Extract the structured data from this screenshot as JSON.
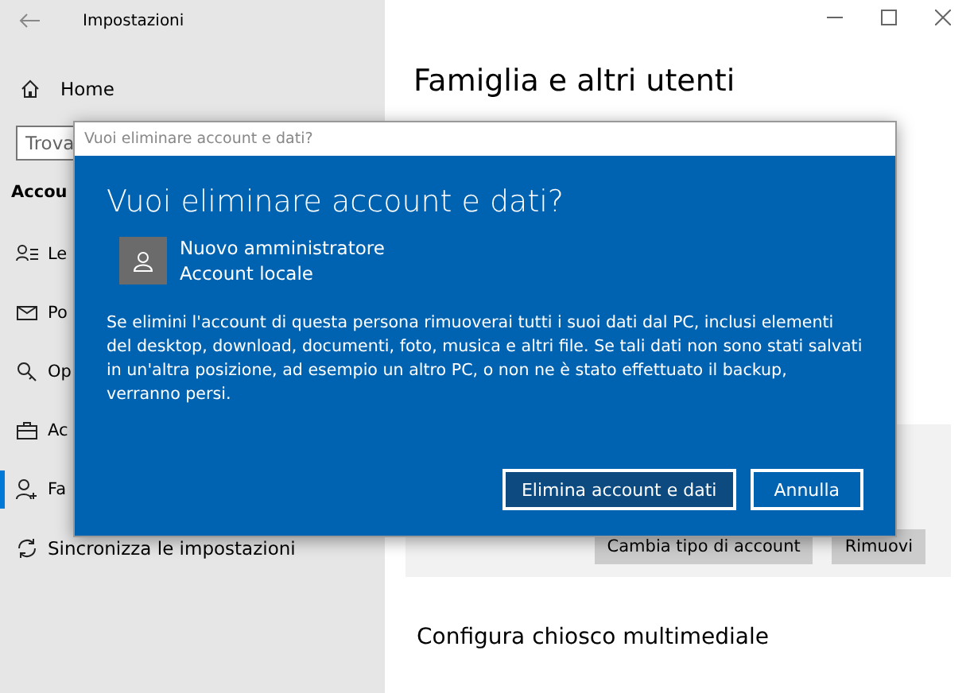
{
  "window": {
    "title": "Impostazioni"
  },
  "sidebar": {
    "home": "Home",
    "search": {
      "value": "Trova"
    },
    "section": "Accou",
    "items": [
      {
        "kind": "person-list",
        "label": "Le",
        "selected": false
      },
      {
        "kind": "mail",
        "label": "Po",
        "selected": false
      },
      {
        "kind": "key",
        "label": "Op",
        "selected": false
      },
      {
        "kind": "briefcase",
        "label": "Ac",
        "selected": false
      },
      {
        "kind": "person-add",
        "label": "Fa",
        "selected": true
      },
      {
        "kind": "sync",
        "label": "Sincronizza le impostazioni",
        "selected": false
      }
    ]
  },
  "content": {
    "title": "Famiglia e altri utenti",
    "account_buttons": [
      "Cambia tipo di account",
      "Rimuovi"
    ],
    "section_title": "Configura chiosco multimediale"
  },
  "dialog": {
    "caption": "Vuoi eliminare account e dati?",
    "heading": "Vuoi eliminare account e dati?",
    "user": {
      "name": "Nuovo amministratore",
      "type": "Account locale"
    },
    "message": "Se elimini l'account di questa persona rimuoverai tutti i suoi dati dal PC, inclusi elementi del desktop, download, documenti, foto, musica e altri file. Se tali dati non sono stati salvati in un'altra posizione, ad esempio un altro PC, o non ne è stato effettuato il backup, verranno persi.",
    "buttons": [
      {
        "label": "Elimina account e dati",
        "kind": "primary"
      },
      {
        "label": "Annulla",
        "kind": "secondary"
      }
    ]
  }
}
